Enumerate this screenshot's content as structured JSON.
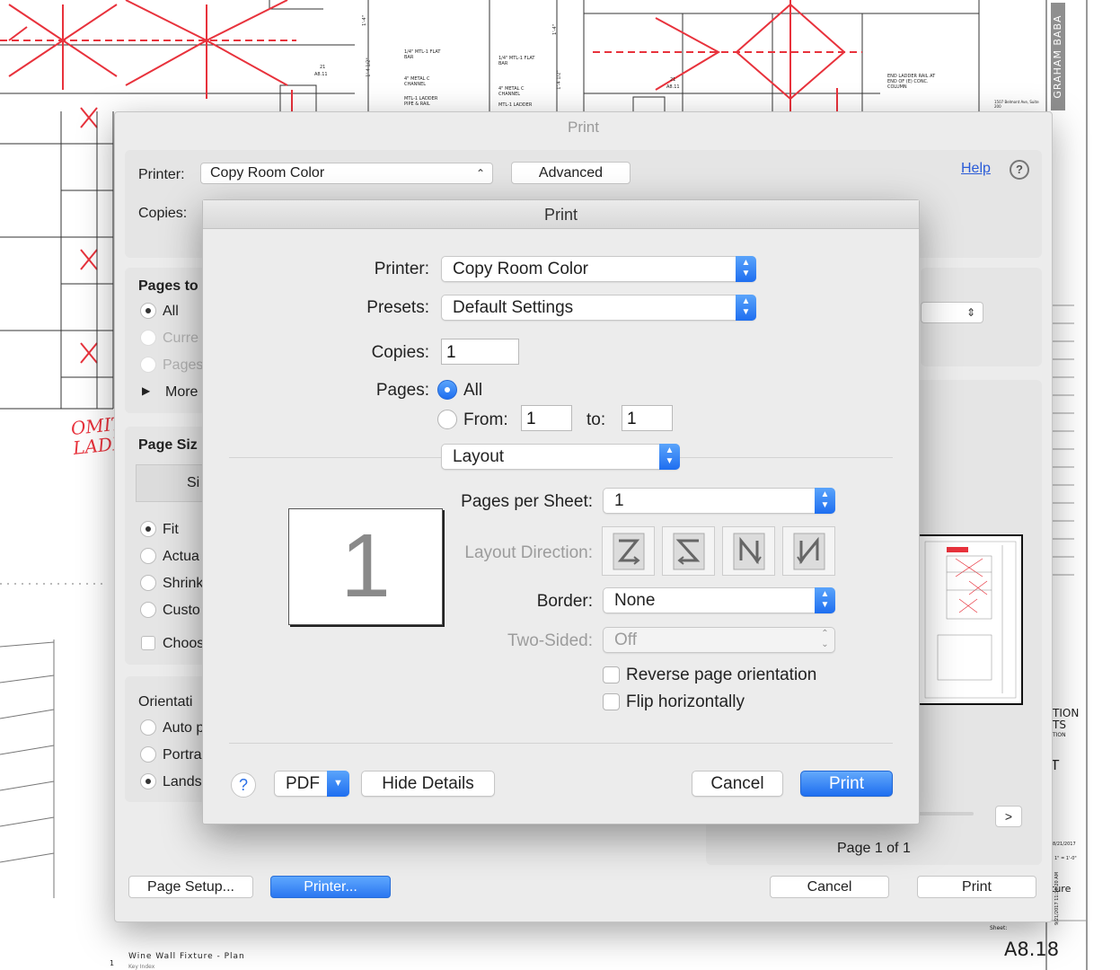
{
  "drawing": {
    "notes": [
      "1/4\" MTL-1 FLAT BAR",
      "4\" METAL C CHANNEL",
      "MTL-1 LADDER PIPE & RAIL",
      "1/4\" MTL-1 FLAT BAR",
      "4\" METAL C CHANNEL",
      "MTL-1 LADDER",
      "END LADDER RAIL AT END OF (E) CONC. COLUMN"
    ],
    "dims": [
      "1'-4 1/2\"",
      "1'-4 1/2\"",
      "1'-4\"",
      "1'-4\""
    ],
    "tags": [
      "21",
      "A8.11",
      "21",
      "A8.11"
    ],
    "handwriting": "OMIT LADDER",
    "architect": "GRAHAM BABA ARCHITECTS",
    "address": "1507 Belmont Ave, Suite 200",
    "sheet_label": "Sheet:",
    "sheet_number": "A8.18",
    "drawing_title": "Wine Wall Fixture - Plan",
    "drawing_scale": "Key Index",
    "drawing_num": "1",
    "date": "8/21/2017",
    "scale_text": "1\" = 1'-0\"",
    "date_stamp": "9/21/2017 11:38:20 AM",
    "right_text_1": "TION",
    "right_text_2": "TS",
    "right_text_3": "TION",
    "right_letter": "T",
    "right_ture": "ture"
  },
  "outer_dialog": {
    "title": "Print",
    "printer_label": "Printer:",
    "printer_value": "Copy Room Color",
    "advanced_button": "Advanced",
    "help_link": "Help",
    "copies_label": "Copies:",
    "pages_heading": "Pages to",
    "pages_options": [
      "All",
      "Curre",
      "Pages"
    ],
    "more_options": "More",
    "page_size_heading": "Page Siz",
    "size_tab": "Si",
    "size_options": [
      "Fit",
      "Actua",
      "Shrink",
      "Custo"
    ],
    "choose_label": "Choos",
    "orientation_heading": "Orientati",
    "orientation_options": [
      "Auto p",
      "Portra",
      "Lands"
    ],
    "next_button": ">",
    "page_indicator": "Page 1 of 1",
    "page_setup_button": "Page Setup...",
    "printer_button": "Printer...",
    "cancel_button": "Cancel",
    "print_button": "Print"
  },
  "print_sheet": {
    "title": "Print",
    "printer_label": "Printer:",
    "printer_value": "Copy Room Color",
    "presets_label": "Presets:",
    "presets_value": "Default Settings",
    "copies_label": "Copies:",
    "copies_value": "1",
    "pages_label": "Pages:",
    "pages_all": "All",
    "pages_from": "From:",
    "pages_from_value": "1",
    "pages_to": "to:",
    "pages_to_value": "1",
    "section_value": "Layout",
    "preview_page_number": "1",
    "pages_per_sheet_label": "Pages per Sheet:",
    "pages_per_sheet_value": "1",
    "layout_direction_label": "Layout Direction:",
    "border_label": "Border:",
    "border_value": "None",
    "two_sided_label": "Two-Sided:",
    "two_sided_value": "Off",
    "reverse_label": "Reverse page orientation",
    "flip_label": "Flip horizontally",
    "help_button": "?",
    "pdf_button": "PDF",
    "hide_details_button": "Hide Details",
    "cancel_button": "Cancel",
    "print_button": "Print"
  },
  "colors": {
    "accent_blue": "#1e6ef0",
    "redline": "#e8323c",
    "dialog_bg": "#ececec"
  }
}
